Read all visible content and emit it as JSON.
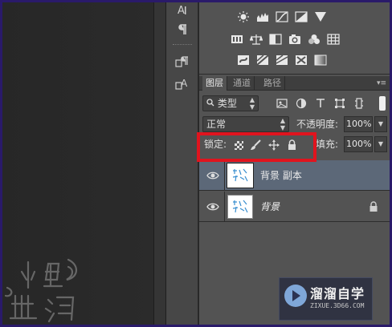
{
  "layers_panel": {
    "tabs": [
      {
        "label": "图层",
        "active": true
      },
      {
        "label": "通道",
        "active": false
      },
      {
        "label": "路径",
        "active": false
      }
    ],
    "filter": {
      "kind_label": "类型"
    },
    "blend_mode": "正常",
    "opacity_label": "不透明度:",
    "opacity_value": "100%",
    "lock_label": "锁定:",
    "fill_label": "填充:",
    "fill_value": "100%",
    "layers": [
      {
        "name": "背景 副本",
        "selected": true,
        "visible": true,
        "locked": false
      },
      {
        "name": "背景",
        "selected": false,
        "visible": true,
        "locked": true
      }
    ]
  },
  "watermark": {
    "title": "溜溜自学",
    "url": "ZIXUE.3D66.COM"
  },
  "colors": {
    "highlight": "#e0141e",
    "selected_row": "#5c6878",
    "panel_bg": "#535353",
    "frame": "#2a1a6a"
  }
}
